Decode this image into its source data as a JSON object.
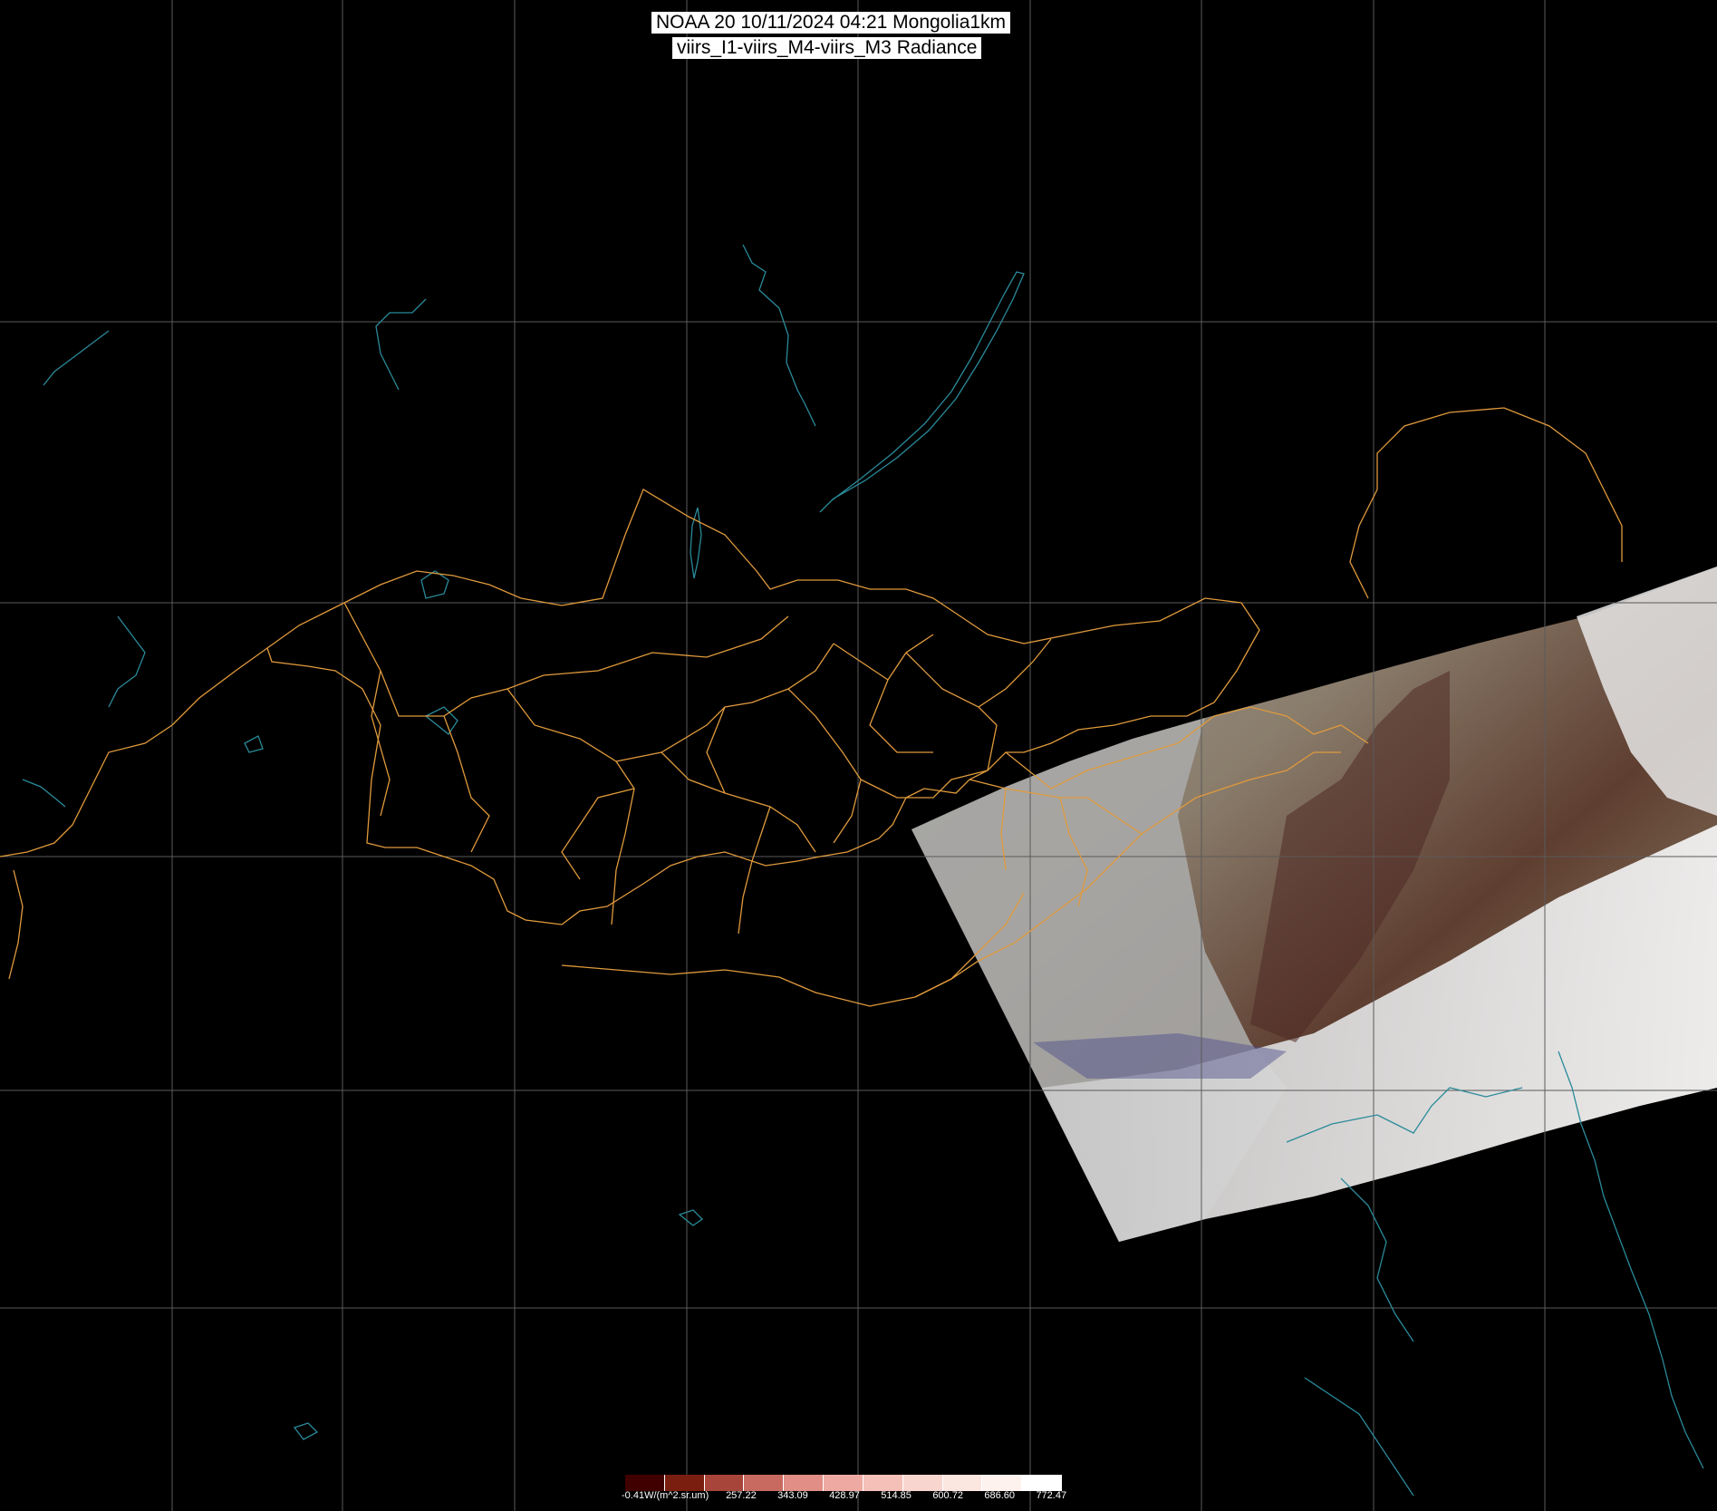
{
  "header": {
    "title_line1": "NOAA 20 10/11/2024 04:21 Mongolia1km",
    "title_line2": "viirs_I1-viirs_M4-viirs_M3 Radiance"
  },
  "colorbar": {
    "unit_label": "-0.41W/(m^2.sr.um)",
    "ticks": [
      "257.22",
      "343.09",
      "428.97",
      "514.85",
      "600.72",
      "686.60",
      "772.47"
    ],
    "colors": [
      "#400000",
      "#7a1e10",
      "#a8453a",
      "#c86a60",
      "#e08e86",
      "#eeaaa2",
      "#f4c0b8",
      "#f8d6cf",
      "#fbe6e0",
      "#fdf2ee",
      "#ffffff"
    ]
  },
  "map_colors": {
    "background": "#000000",
    "graticule": "#5a5a5a",
    "borders": "#e09a3c",
    "coast": "#2a8a9a",
    "land_brown": "#6b5a48",
    "cloud": "#d8d8d8"
  }
}
